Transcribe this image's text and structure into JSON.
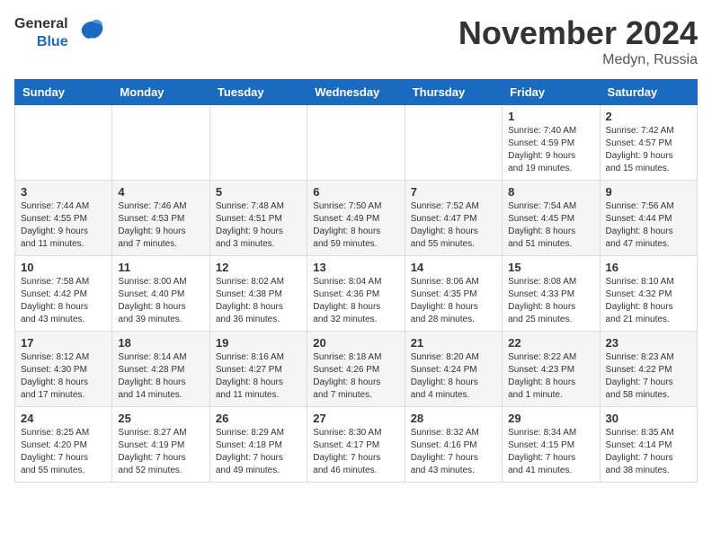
{
  "logo": {
    "general": "General",
    "blue": "Blue"
  },
  "title": "November 2024",
  "location": "Medyn, Russia",
  "days_header": [
    "Sunday",
    "Monday",
    "Tuesday",
    "Wednesday",
    "Thursday",
    "Friday",
    "Saturday"
  ],
  "weeks": [
    [
      {
        "day": "",
        "info": ""
      },
      {
        "day": "",
        "info": ""
      },
      {
        "day": "",
        "info": ""
      },
      {
        "day": "",
        "info": ""
      },
      {
        "day": "",
        "info": ""
      },
      {
        "day": "1",
        "info": "Sunrise: 7:40 AM\nSunset: 4:59 PM\nDaylight: 9 hours\nand 19 minutes."
      },
      {
        "day": "2",
        "info": "Sunrise: 7:42 AM\nSunset: 4:57 PM\nDaylight: 9 hours\nand 15 minutes."
      }
    ],
    [
      {
        "day": "3",
        "info": "Sunrise: 7:44 AM\nSunset: 4:55 PM\nDaylight: 9 hours\nand 11 minutes."
      },
      {
        "day": "4",
        "info": "Sunrise: 7:46 AM\nSunset: 4:53 PM\nDaylight: 9 hours\nand 7 minutes."
      },
      {
        "day": "5",
        "info": "Sunrise: 7:48 AM\nSunset: 4:51 PM\nDaylight: 9 hours\nand 3 minutes."
      },
      {
        "day": "6",
        "info": "Sunrise: 7:50 AM\nSunset: 4:49 PM\nDaylight: 8 hours\nand 59 minutes."
      },
      {
        "day": "7",
        "info": "Sunrise: 7:52 AM\nSunset: 4:47 PM\nDaylight: 8 hours\nand 55 minutes."
      },
      {
        "day": "8",
        "info": "Sunrise: 7:54 AM\nSunset: 4:45 PM\nDaylight: 8 hours\nand 51 minutes."
      },
      {
        "day": "9",
        "info": "Sunrise: 7:56 AM\nSunset: 4:44 PM\nDaylight: 8 hours\nand 47 minutes."
      }
    ],
    [
      {
        "day": "10",
        "info": "Sunrise: 7:58 AM\nSunset: 4:42 PM\nDaylight: 8 hours\nand 43 minutes."
      },
      {
        "day": "11",
        "info": "Sunrise: 8:00 AM\nSunset: 4:40 PM\nDaylight: 8 hours\nand 39 minutes."
      },
      {
        "day": "12",
        "info": "Sunrise: 8:02 AM\nSunset: 4:38 PM\nDaylight: 8 hours\nand 36 minutes."
      },
      {
        "day": "13",
        "info": "Sunrise: 8:04 AM\nSunset: 4:36 PM\nDaylight: 8 hours\nand 32 minutes."
      },
      {
        "day": "14",
        "info": "Sunrise: 8:06 AM\nSunset: 4:35 PM\nDaylight: 8 hours\nand 28 minutes."
      },
      {
        "day": "15",
        "info": "Sunrise: 8:08 AM\nSunset: 4:33 PM\nDaylight: 8 hours\nand 25 minutes."
      },
      {
        "day": "16",
        "info": "Sunrise: 8:10 AM\nSunset: 4:32 PM\nDaylight: 8 hours\nand 21 minutes."
      }
    ],
    [
      {
        "day": "17",
        "info": "Sunrise: 8:12 AM\nSunset: 4:30 PM\nDaylight: 8 hours\nand 17 minutes."
      },
      {
        "day": "18",
        "info": "Sunrise: 8:14 AM\nSunset: 4:28 PM\nDaylight: 8 hours\nand 14 minutes."
      },
      {
        "day": "19",
        "info": "Sunrise: 8:16 AM\nSunset: 4:27 PM\nDaylight: 8 hours\nand 11 minutes."
      },
      {
        "day": "20",
        "info": "Sunrise: 8:18 AM\nSunset: 4:26 PM\nDaylight: 8 hours\nand 7 minutes."
      },
      {
        "day": "21",
        "info": "Sunrise: 8:20 AM\nSunset: 4:24 PM\nDaylight: 8 hours\nand 4 minutes."
      },
      {
        "day": "22",
        "info": "Sunrise: 8:22 AM\nSunset: 4:23 PM\nDaylight: 8 hours\nand 1 minute."
      },
      {
        "day": "23",
        "info": "Sunrise: 8:23 AM\nSunset: 4:22 PM\nDaylight: 7 hours\nand 58 minutes."
      }
    ],
    [
      {
        "day": "24",
        "info": "Sunrise: 8:25 AM\nSunset: 4:20 PM\nDaylight: 7 hours\nand 55 minutes."
      },
      {
        "day": "25",
        "info": "Sunrise: 8:27 AM\nSunset: 4:19 PM\nDaylight: 7 hours\nand 52 minutes."
      },
      {
        "day": "26",
        "info": "Sunrise: 8:29 AM\nSunset: 4:18 PM\nDaylight: 7 hours\nand 49 minutes."
      },
      {
        "day": "27",
        "info": "Sunrise: 8:30 AM\nSunset: 4:17 PM\nDaylight: 7 hours\nand 46 minutes."
      },
      {
        "day": "28",
        "info": "Sunrise: 8:32 AM\nSunset: 4:16 PM\nDaylight: 7 hours\nand 43 minutes."
      },
      {
        "day": "29",
        "info": "Sunrise: 8:34 AM\nSunset: 4:15 PM\nDaylight: 7 hours\nand 41 minutes."
      },
      {
        "day": "30",
        "info": "Sunrise: 8:35 AM\nSunset: 4:14 PM\nDaylight: 7 hours\nand 38 minutes."
      }
    ]
  ]
}
